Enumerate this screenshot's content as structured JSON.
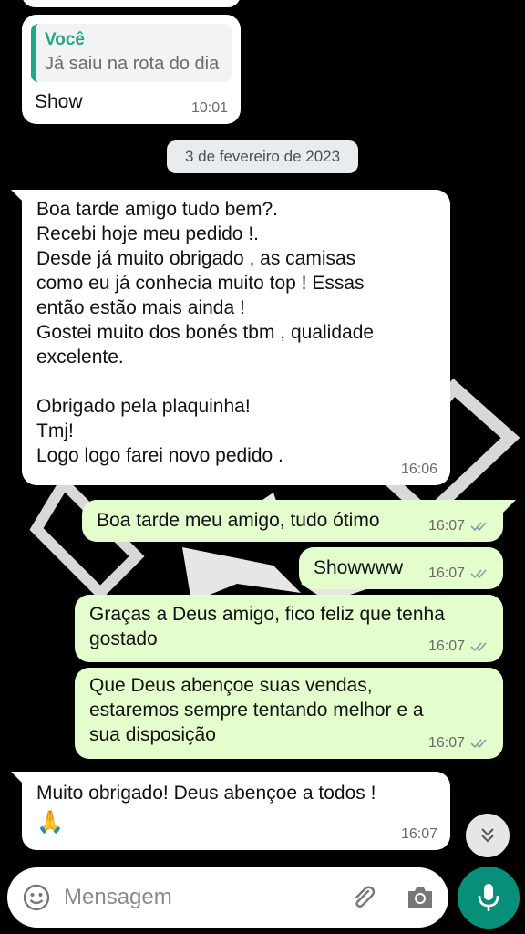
{
  "chat": {
    "quoted_message": {
      "author": "Você",
      "text": "Já saiu na rota do dia",
      "reply": "Show",
      "time": "10:01"
    },
    "date_separator": "3 de fevereiro de 2023",
    "messages": [
      {
        "direction": "incoming",
        "text": "Boa tarde amigo tudo bem?.\nRecebi hoje meu pedido !.\nDesde já muito obrigado , as camisas\ncomo eu já conhecia muito top ! Essas\nentão estão mais ainda !\nGostei muito dos bonés tbm , qualidade\nexcelente.\n\nObrigado pela plaquinha!\nTmj!\nLogo logo farei novo pedido .",
        "time": "16:06"
      },
      {
        "direction": "outgoing",
        "text": "Boa tarde meu amigo, tudo ótimo",
        "time": "16:07",
        "status": "read"
      },
      {
        "direction": "outgoing",
        "text": "Showwww",
        "time": "16:07",
        "status": "read"
      },
      {
        "direction": "outgoing",
        "text": "Graças a Deus amigo, fico feliz que tenha\ngostado",
        "time": "16:07",
        "status": "read"
      },
      {
        "direction": "outgoing",
        "text": "Que Deus abençoe suas vendas,\nestaremos sempre tentando melhor e a\nsua disposição",
        "time": "16:07",
        "status": "read"
      },
      {
        "direction": "incoming",
        "text": "Muito obrigado! Deus abençoe a todos !",
        "emoji": "🙏",
        "time": "16:07"
      }
    ]
  },
  "composer": {
    "placeholder": "Mensagem",
    "icons": [
      "emoji-icon",
      "paperclip-icon",
      "camera-icon",
      "microphone-icon"
    ]
  },
  "scroll_down_icon": "double-chevron-down-icon",
  "colors": {
    "background": "#000000",
    "incoming_bubble": "#ffffff",
    "outgoing_bubble": "#e3fdcc",
    "accent": "#1fa886",
    "mic_button": "#06907a"
  }
}
